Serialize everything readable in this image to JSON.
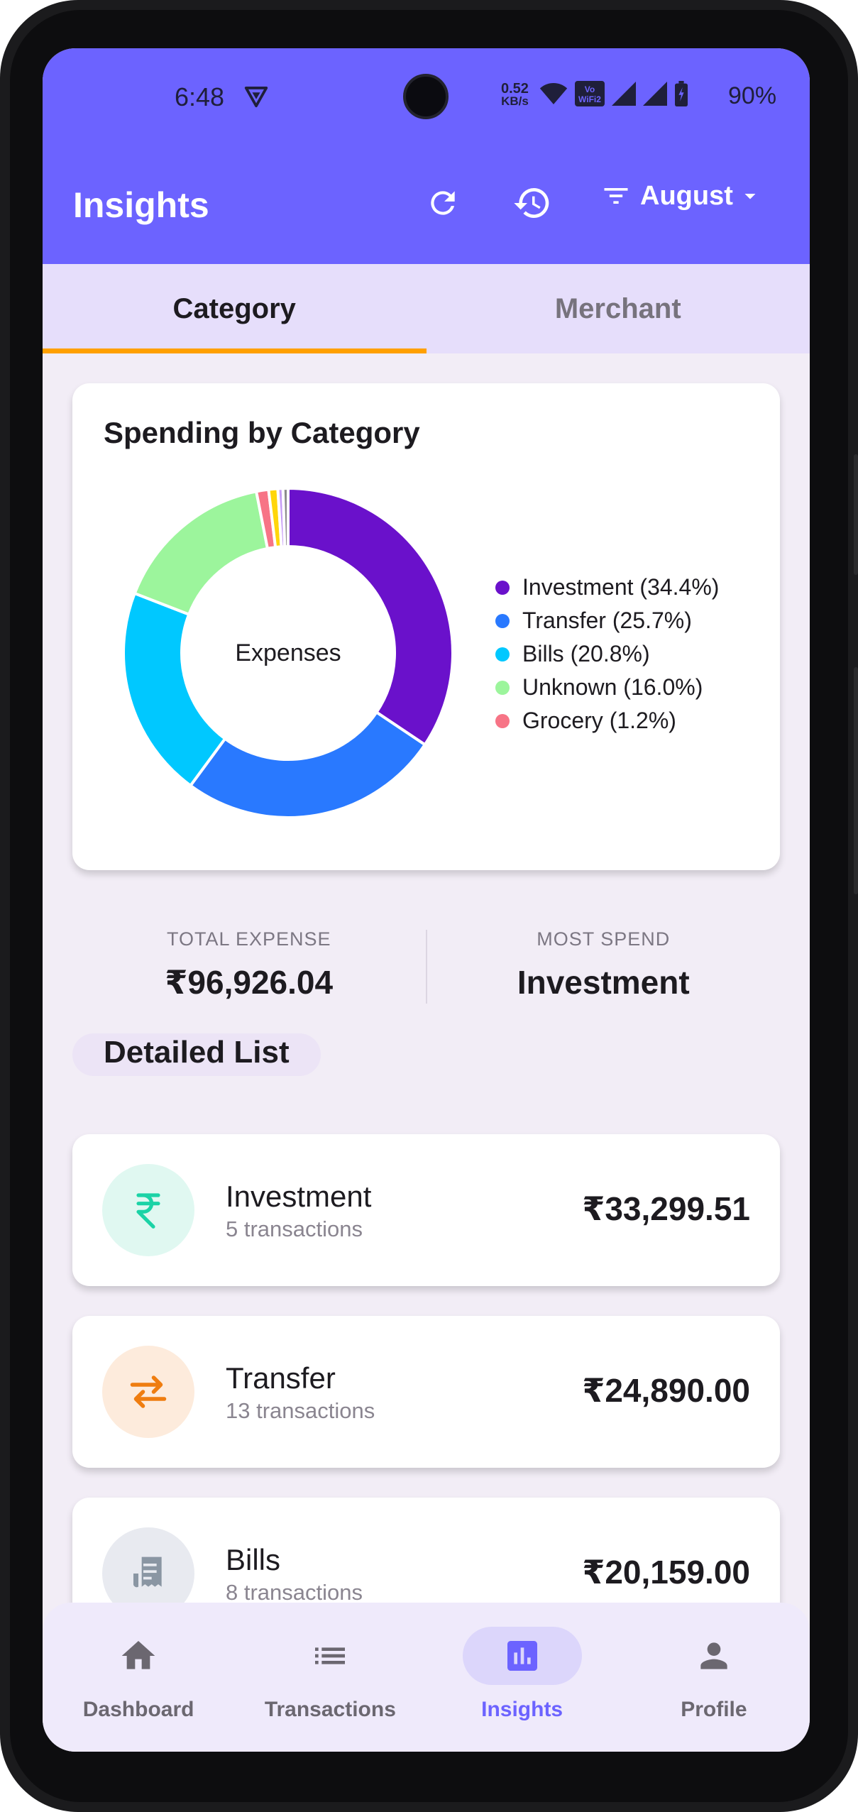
{
  "status_bar": {
    "time": "6:48",
    "speed_value": "0.52",
    "speed_unit": "KB/s",
    "wifi_badge_top": "Vo",
    "wifi_badge_bottom": "WiFi2",
    "battery": "90%"
  },
  "app_bar": {
    "title": "Insights",
    "month_filter": "August",
    "accent_color": "#6c63ff"
  },
  "tabs": [
    {
      "label": "Category",
      "active": true
    },
    {
      "label": "Merchant",
      "active": false
    }
  ],
  "chart_card": {
    "title": "Spending by Category",
    "center_label": "Expenses"
  },
  "chart_data": {
    "type": "pie",
    "title": "Spending by Category",
    "center_label": "Expenses",
    "series": [
      {
        "name": "Investment",
        "percent": 34.4,
        "color": "#6a11cb",
        "label": "Investment (34.4%)"
      },
      {
        "name": "Transfer",
        "percent": 25.7,
        "color": "#2979ff",
        "label": "Transfer (25.7%)"
      },
      {
        "name": "Bills",
        "percent": 20.8,
        "color": "#00c8ff",
        "label": "Bills (20.8%)"
      },
      {
        "name": "Unknown",
        "percent": 16.0,
        "color": "#9cf59c",
        "label": "Unknown (16.0%)"
      },
      {
        "name": "Grocery",
        "percent": 1.2,
        "color": "#f77486",
        "label": "Grocery (1.2%)"
      },
      {
        "name": "",
        "percent": 0.9,
        "color": "#ffd60a",
        "label": ""
      },
      {
        "name": "",
        "percent": 0.5,
        "color": "#c59bf5",
        "label": ""
      },
      {
        "name": "",
        "percent": 0.5,
        "color": "#8b8b8b",
        "label": ""
      }
    ],
    "legend_position": "right"
  },
  "summary": {
    "total_label": "TOTAL EXPENSE",
    "total_value": "₹96,926.04",
    "most_label": "MOST SPEND",
    "most_value": "Investment"
  },
  "detailed_list": {
    "title": "Detailed List",
    "items": [
      {
        "name": "Investment",
        "sub": "5 transactions",
        "amount": "₹33,299.51",
        "icon": "rupee-icon",
        "icon_bg": "#e0f8f1",
        "icon_color": "#1bd3a6"
      },
      {
        "name": "Transfer",
        "sub": "13 transactions",
        "amount": "₹24,890.00",
        "icon": "swap-arrows-icon",
        "icon_bg": "#fdebdc",
        "icon_color": "#ef7d10"
      },
      {
        "name": "Bills",
        "sub": "8 transactions",
        "amount": "₹20,159.00",
        "icon": "receipt-icon",
        "icon_bg": "#e8eaf0",
        "icon_color": "#8a96a3"
      }
    ]
  },
  "bottom_nav": [
    {
      "label": "Dashboard",
      "icon": "home-icon",
      "active": false
    },
    {
      "label": "Transactions",
      "icon": "list-icon",
      "active": false
    },
    {
      "label": "Insights",
      "icon": "bar-chart-icon",
      "active": true
    },
    {
      "label": "Profile",
      "icon": "person-icon",
      "active": false
    }
  ]
}
